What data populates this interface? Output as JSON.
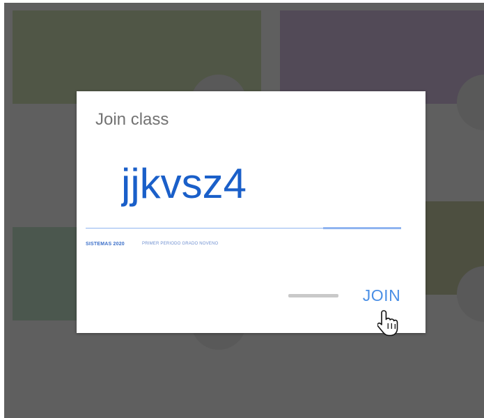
{
  "dialog": {
    "title": "Join class",
    "class_code_value": "jjkvsz4",
    "class_name": "SISTEMAS 2020",
    "class_section": "PRIMER PERIODO GRADO NOVENO",
    "join_label": "JOIN"
  },
  "cursor": {
    "icon": "hand-pointer-icon"
  },
  "colors": {
    "accent": "#4a8fe6",
    "code_text": "#1a5fc9",
    "overlay": "#5f5f5f"
  }
}
